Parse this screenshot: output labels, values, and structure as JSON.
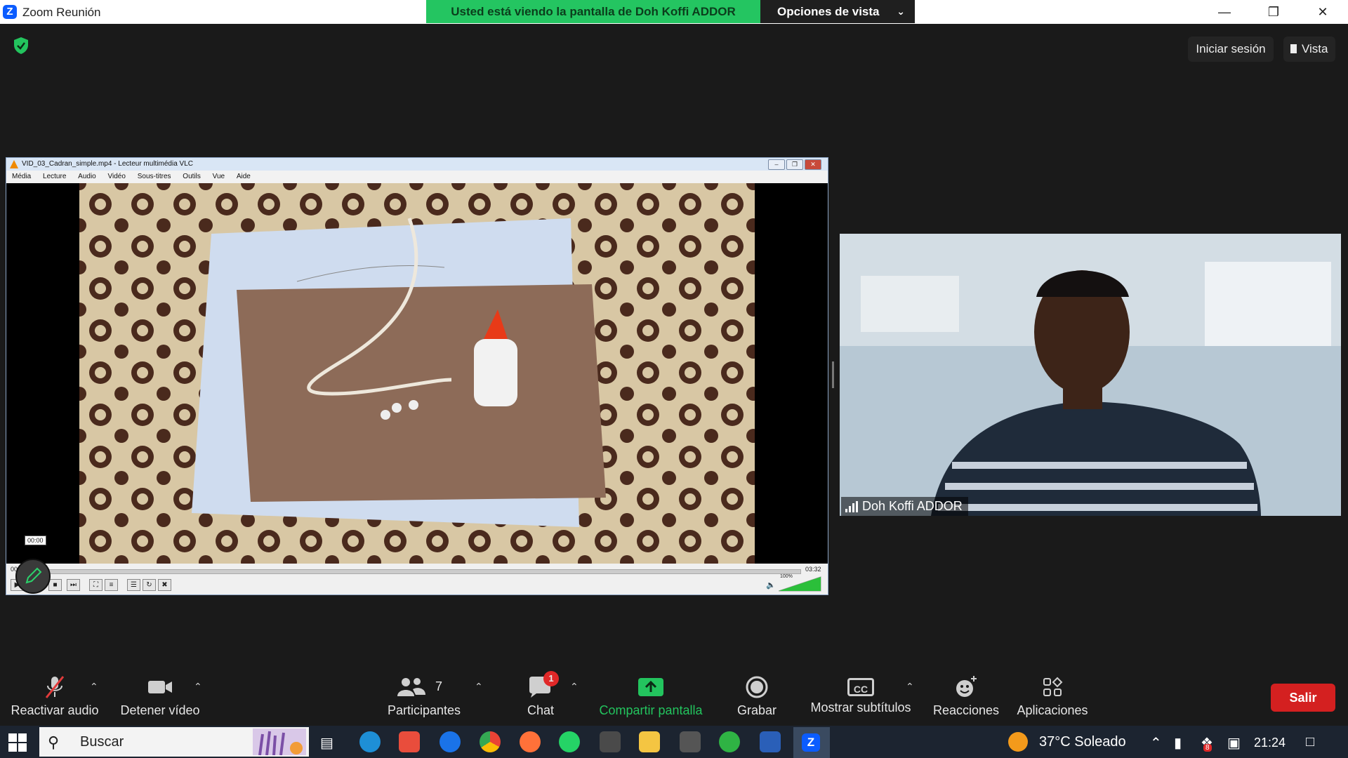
{
  "window": {
    "app_title": "Zoom Reunión"
  },
  "share_banner": {
    "text": "Usted está viendo la pantalla de Doh Koffi ADDOR",
    "view_options": "Opciones de vista"
  },
  "header": {
    "signin": "Iniciar sesión",
    "view": "Vista"
  },
  "vlc": {
    "title": "VID_03_Cadran_simple.mp4 - Lecteur multimédia VLC",
    "menu": [
      "Média",
      "Lecture",
      "Audio",
      "Vidéo",
      "Sous-titres",
      "Outils",
      "Vue",
      "Aide"
    ],
    "time_tooltip": "00:00",
    "elapsed": "00:00",
    "duration": "03:32",
    "volume": "100%",
    "volume_level": 1.0
  },
  "participant": {
    "name": "Doh Koffi ADDOR"
  },
  "toolbar": {
    "unmute": "Reactivar audio",
    "stop_video": "Detener vídeo",
    "participants": "Participantes",
    "participants_count": "7",
    "chat": "Chat",
    "chat_badge": "1",
    "share": "Compartir pantalla",
    "record": "Grabar",
    "captions": "Mostrar subtítulos",
    "captions_icon_text": "CC",
    "reactions": "Reacciones",
    "apps": "Aplicaciones",
    "leave": "Salir"
  },
  "taskbar": {
    "search": "Buscar",
    "weather": "37°C Soleado",
    "clock": "21:24",
    "tray_badge": "8"
  },
  "colors": {
    "zoom_blue": "#0b5cff",
    "share_green": "#24c561",
    "leave_red": "#d42020"
  }
}
